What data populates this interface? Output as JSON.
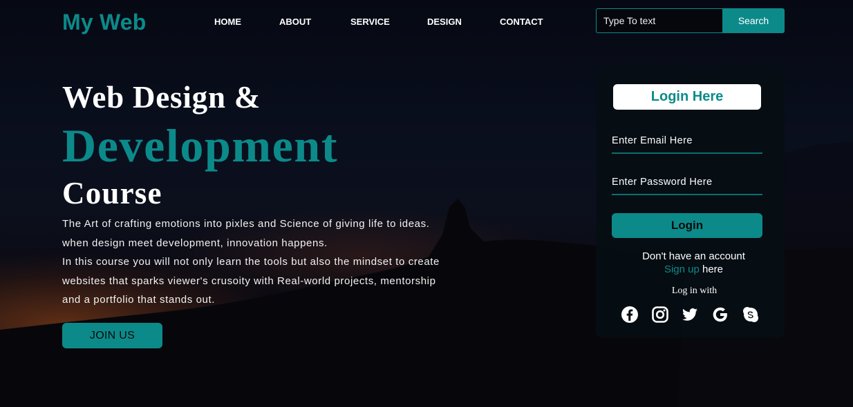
{
  "brand": {
    "logo": "My Web"
  },
  "nav": {
    "items": [
      "HOME",
      "ABOUT",
      "SERVICE",
      "DESIGN",
      "CONTACT"
    ]
  },
  "search": {
    "placeholder": "Type To text",
    "button_label": "Search"
  },
  "hero": {
    "line1": "Web Design &",
    "line2": "Development",
    "line3": "Course",
    "paragraph_lines": [
      "The Art of crafting emotions into pixles and Science of giving life to ideas.",
      "when design meet development, innovation happens.",
      "In this course you will not only learn the tools but also the mindset to create",
      "websites that sparks viewer's crusoity with Real-world projects, mentorship",
      "and a portfolio that stands out."
    ],
    "cta_label": "JOIN US"
  },
  "login": {
    "title": "Login Here",
    "email_placeholder": "Enter Email Here",
    "password_placeholder": "Enter Password Here",
    "button_label": "Login",
    "no_account_text": "Don't have an account",
    "signup_link": "Sign up",
    "signup_suffix": " here",
    "login_with": "Log in with",
    "socials": [
      "facebook-icon",
      "instagram-icon",
      "twitter-icon",
      "google-icon",
      "skype-icon"
    ]
  },
  "colors": {
    "accent": "#0c8a8a",
    "background": "#0a0f1e",
    "card": "#060e14"
  }
}
